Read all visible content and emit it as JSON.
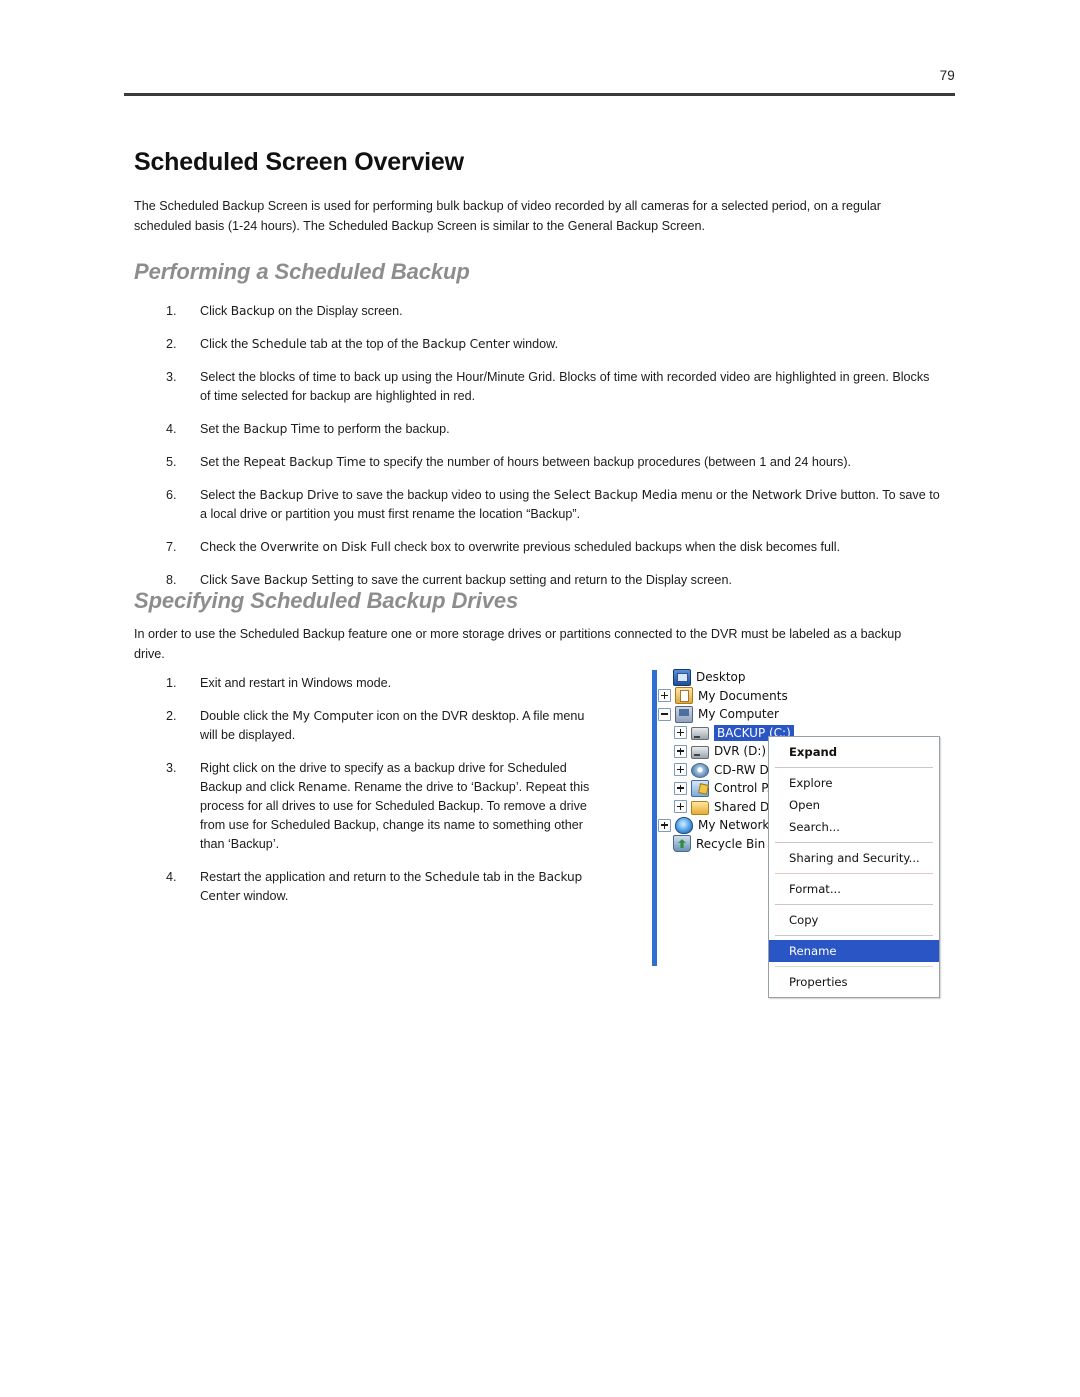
{
  "header": {
    "page_number": "79"
  },
  "sections": {
    "overview": {
      "heading": "Scheduled Screen Overview",
      "paragraph": "The Scheduled Backup Screen is used for performing bulk backup of video recorded by all cameras for a selected period, on a regular scheduled basis (1-24 hours).  The Scheduled Backup Screen is similar to the General Backup Screen."
    },
    "performing": {
      "heading": "Performing a Scheduled Backup",
      "steps": [
        {
          "num": "1.",
          "parts": [
            {
              "t": "Click ",
              "ui": false
            },
            {
              "t": "Backup",
              "ui": true
            },
            {
              "t": " on the Display screen.",
              "ui": false
            }
          ]
        },
        {
          "num": "2.",
          "parts": [
            {
              "t": "Click the ",
              "ui": false
            },
            {
              "t": "Schedule",
              "ui": true
            },
            {
              "t": " tab at the top of the ",
              "ui": false
            },
            {
              "t": "Backup Center",
              "ui": true
            },
            {
              "t": " window.",
              "ui": false
            }
          ]
        },
        {
          "num": "3.",
          "parts": [
            {
              "t": "Select the blocks of time to back up using the Hour/Minute Grid. Blocks of time with recorded video are highlighted in green. Blocks of time selected for backup are highlighted in red.",
              "ui": false
            }
          ]
        },
        {
          "num": "4.",
          "parts": [
            {
              "t": "Set the ",
              "ui": false
            },
            {
              "t": "Backup Time",
              "ui": true
            },
            {
              "t": " to perform the backup.",
              "ui": false
            }
          ]
        },
        {
          "num": "5.",
          "parts": [
            {
              "t": "Set the ",
              "ui": false
            },
            {
              "t": "Repeat Backup Time",
              "ui": true
            },
            {
              "t": " to specify the number of hours between backup procedures (between 1 and 24 hours).",
              "ui": false
            }
          ]
        },
        {
          "num": "6.",
          "parts": [
            {
              "t": "Select the ",
              "ui": false
            },
            {
              "t": "Backup Drive",
              "ui": true
            },
            {
              "t": " to save the backup video to using the ",
              "ui": false
            },
            {
              "t": "Select Backup Media",
              "ui": true
            },
            {
              "t": " menu or the ",
              "ui": false
            },
            {
              "t": "Network Drive",
              "ui": true
            },
            {
              "t": " button. To save to a local drive or partition you must first rename the location “Backup”.",
              "ui": false
            }
          ]
        },
        {
          "num": "7.",
          "parts": [
            {
              "t": "Check the ",
              "ui": false
            },
            {
              "t": "Overwrite on Disk Full",
              "ui": true
            },
            {
              "t": " check box to overwrite previous scheduled backups when the disk becomes full.",
              "ui": false
            }
          ]
        },
        {
          "num": "8.",
          "parts": [
            {
              "t": "Click ",
              "ui": false
            },
            {
              "t": "Save Backup Setting",
              "ui": true
            },
            {
              "t": " to save the current backup setting and return to the Display screen.",
              "ui": false
            }
          ]
        }
      ]
    },
    "specifying": {
      "heading": "Specifying Scheduled Backup Drives",
      "paragraph": "In order to use the Scheduled Backup feature one or more storage drives or partitions connected to the DVR must be labeled as a backup drive.",
      "steps": [
        {
          "num": "1.",
          "parts": [
            {
              "t": "Exit and restart in Windows mode.",
              "ui": false
            }
          ]
        },
        {
          "num": "2.",
          "parts": [
            {
              "t": "Double click the ",
              "ui": false
            },
            {
              "t": "My Computer",
              "ui": true
            },
            {
              "t": " icon on the DVR desktop.  A file menu will be displayed.",
              "ui": false
            }
          ]
        },
        {
          "num": "3.",
          "parts": [
            {
              "t": "Right click on the drive to specify as a backup drive for Scheduled Backup and click ",
              "ui": false
            },
            {
              "t": "Rename",
              "ui": true
            },
            {
              "t": ". Rename the drive to ‘Backup’. Repeat this process for all drives to use for Scheduled Backup. To remove a drive from use for Scheduled Backup, change its name to something other than ‘Backup’.",
              "ui": false
            }
          ]
        },
        {
          "num": "4.",
          "parts": [
            {
              "t": "Restart the application and return to the ",
              "ui": false
            },
            {
              "t": "Schedule",
              "ui": true
            },
            {
              "t": " tab in the ",
              "ui": false
            },
            {
              "t": "Backup Center",
              "ui": true
            },
            {
              "t": " window.",
              "ui": false
            }
          ]
        }
      ]
    }
  },
  "screenshot": {
    "tree": [
      {
        "label": "Desktop",
        "icon": "desktop-icon",
        "indent": 0,
        "toggle": "none",
        "selected": false
      },
      {
        "label": "My Documents",
        "icon": "documents-icon",
        "indent": 1,
        "toggle": "expand",
        "selected": false
      },
      {
        "label": "My Computer",
        "icon": "computer-icon",
        "indent": 1,
        "toggle": "collapse",
        "selected": false
      },
      {
        "label": "BACKUP (C:)",
        "icon": "hard-drive-icon",
        "indent": 2,
        "toggle": "expand",
        "selected": true
      },
      {
        "label": "DVR (D:)",
        "icon": "hard-drive-icon",
        "indent": 2,
        "toggle": "expand",
        "selected": false
      },
      {
        "label": "CD-RW D",
        "icon": "cd-drive-icon",
        "indent": 2,
        "toggle": "expand",
        "selected": false
      },
      {
        "label": "Control P.",
        "icon": "control-panel-icon",
        "indent": 2,
        "toggle": "expand",
        "selected": false
      },
      {
        "label": "Shared D",
        "icon": "folder-icon",
        "indent": 2,
        "toggle": "expand",
        "selected": false
      },
      {
        "label": "My Network P",
        "icon": "network-icon",
        "indent": 1,
        "toggle": "expand",
        "selected": false
      },
      {
        "label": "Recycle Bin",
        "icon": "recycle-bin-icon",
        "indent": 1,
        "toggle": "none",
        "selected": false
      }
    ],
    "context_menu": [
      {
        "type": "item",
        "label": "Expand",
        "bold": true,
        "selected": false
      },
      {
        "type": "separator",
        "tone": "gray"
      },
      {
        "type": "item",
        "label": "Explore",
        "bold": false,
        "selected": false
      },
      {
        "type": "item",
        "label": "Open",
        "bold": false,
        "selected": false
      },
      {
        "type": "item",
        "label": "Search...",
        "bold": false,
        "selected": false
      },
      {
        "type": "separator",
        "tone": "gray"
      },
      {
        "type": "item",
        "label": "Sharing and Security...",
        "bold": false,
        "selected": false
      },
      {
        "type": "separator",
        "tone": "pink"
      },
      {
        "type": "item",
        "label": "Format...",
        "bold": false,
        "selected": false
      },
      {
        "type": "separator",
        "tone": "gray"
      },
      {
        "type": "item",
        "label": "Copy",
        "bold": false,
        "selected": false
      },
      {
        "type": "separator",
        "tone": "gray"
      },
      {
        "type": "item",
        "label": "Rename",
        "bold": false,
        "selected": true
      },
      {
        "type": "separator",
        "tone": "cream"
      },
      {
        "type": "item",
        "label": "Properties",
        "bold": false,
        "selected": false
      }
    ],
    "colors": {
      "selection_blue": "#2a55c4",
      "side_bar_blue": "#2f6fd0"
    }
  }
}
